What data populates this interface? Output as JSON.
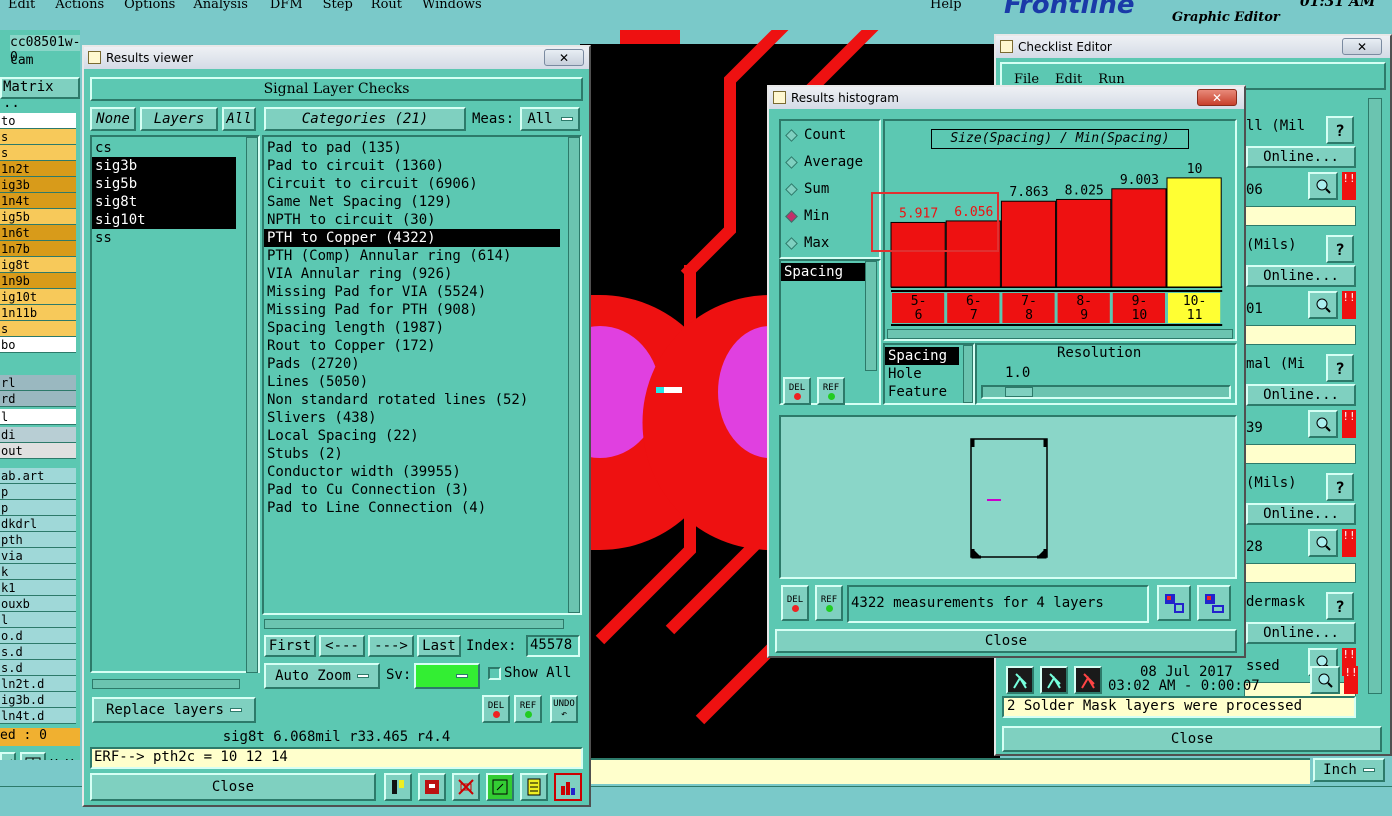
{
  "menubar": {
    "items": [
      "Edit",
      "Actions",
      "Options",
      "Analysis",
      "DFM",
      "Step",
      "Rout",
      "Windows"
    ],
    "help": "Help"
  },
  "brand": {
    "logo": "Frontline",
    "subtitle": "Graphic Editor",
    "time": "01:31 AM"
  },
  "left_panel": {
    "job": "cc08501w-0",
    "step": "cam",
    "matrix": "Matrix ..",
    "layers": [
      {
        "name": "to",
        "color": "#ffffff"
      },
      {
        "name": "s",
        "color": "#f7c95a"
      },
      {
        "name": "s",
        "color": "#f7c95a"
      },
      {
        "name": "1n2t",
        "color": "#d89b1a"
      },
      {
        "name": "ig3b",
        "color": "#d89b1a"
      },
      {
        "name": "1n4t",
        "color": "#d89b1a"
      },
      {
        "name": "ig5b",
        "color": "#f7c95a"
      },
      {
        "name": "1n6t",
        "color": "#d89b1a"
      },
      {
        "name": "1n7b",
        "color": "#d89b1a"
      },
      {
        "name": "ig8t",
        "color": "#f7c95a"
      },
      {
        "name": "1n9b",
        "color": "#d89b1a"
      },
      {
        "name": "ig10t",
        "color": "#f7c95a"
      },
      {
        "name": "1n11b",
        "color": "#f7c95a"
      },
      {
        "name": "s",
        "color": "#f7c95a"
      },
      {
        "name": "bo",
        "color": "#ffffff"
      }
    ],
    "layers2": [
      {
        "name": "rl",
        "color": "#9ab8c0"
      },
      {
        "name": "rd",
        "color": "#9ab8c0"
      },
      {
        "name": "l",
        "color": "#ffffff"
      },
      {
        "name": "di",
        "color": "#b8ced4"
      },
      {
        "name": "out",
        "color": "#e0e0e0"
      }
    ],
    "layers3": [
      "ab.art",
      "p",
      "p",
      "dkdrl",
      "pth",
      "via",
      "k",
      "k1",
      "ouxb",
      "l",
      "o.d",
      "s.d",
      "s.d",
      "ln2t.d",
      "ig3b.d",
      "ln4t.d"
    ],
    "status": "ed : 0",
    "xy": "X Y"
  },
  "results_viewer": {
    "title": "Results viewer",
    "header": "Signal Layer Checks",
    "none_btn": "None",
    "layers_btn": "Layers",
    "all_btn": "All",
    "layers_list": [
      {
        "name": "cs",
        "selected": false
      },
      {
        "name": "sig3b",
        "selected": true
      },
      {
        "name": "sig5b",
        "selected": true
      },
      {
        "name": "sig8t",
        "selected": true
      },
      {
        "name": "sig10t",
        "selected": true
      },
      {
        "name": "ss",
        "selected": false
      }
    ],
    "categories_label": "Categories (21)",
    "meas_label": "Meas:",
    "meas_value": "All",
    "categories": [
      {
        "label": "Pad to pad (135)",
        "selected": false
      },
      {
        "label": "Pad to circuit (1360)",
        "selected": false
      },
      {
        "label": "Circuit to circuit (6906)",
        "selected": false
      },
      {
        "label": "Same Net Spacing (129)",
        "selected": false
      },
      {
        "label": "NPTH to circuit (30)",
        "selected": false
      },
      {
        "label": "PTH to Copper (4322)",
        "selected": true
      },
      {
        "label": "PTH (Comp) Annular ring (614)",
        "selected": false
      },
      {
        "label": "VIA Annular ring (926)",
        "selected": false
      },
      {
        "label": "Missing Pad for VIA (5524)",
        "selected": false
      },
      {
        "label": "Missing Pad for PTH (908)",
        "selected": false
      },
      {
        "label": "Spacing length (1987)",
        "selected": false
      },
      {
        "label": "Rout to Copper (172)",
        "selected": false
      },
      {
        "label": "Pads (2720)",
        "selected": false
      },
      {
        "label": "Lines (5050)",
        "selected": false
      },
      {
        "label": "Non standard rotated lines (52)",
        "selected": false
      },
      {
        "label": "Slivers (438)",
        "selected": false
      },
      {
        "label": "Local Spacing (22)",
        "selected": false
      },
      {
        "label": "Stubs (2)",
        "selected": false
      },
      {
        "label": "Conductor width (39955)",
        "selected": false
      },
      {
        "label": "Pad to Cu Connection (3)",
        "selected": false
      },
      {
        "label": "Pad to Line Connection (4)",
        "selected": false
      }
    ],
    "first": "First",
    "prev": "<---",
    "next": "--->",
    "last": "Last",
    "index_label": "Index:",
    "index_value": "45578",
    "auto_zoom": "Auto Zoom",
    "sv_label": "Sv:",
    "show_all": "Show All",
    "replace_layers": "Replace layers",
    "del": "DEL",
    "ref": "REF",
    "undo": "UNDO",
    "info": "sig8t 6.068mil  r33.465  r4.4",
    "erf": "ERF--> pth2c = 10 12 14",
    "close": "Close"
  },
  "histogram": {
    "title": "Results histogram",
    "modes": [
      {
        "label": "Count",
        "selected": false
      },
      {
        "label": "Average",
        "selected": false
      },
      {
        "label": "Sum",
        "selected": false
      },
      {
        "label": "Min",
        "selected": true
      },
      {
        "label": "Max",
        "selected": false
      }
    ],
    "attr_list": [
      "Spacing"
    ],
    "chart_title": "Size(Spacing) / Min(Spacing)",
    "del": "DEL",
    "ref": "REF",
    "type_options": [
      {
        "label": "Spacing",
        "selected": true
      },
      {
        "label": "Hole",
        "selected": false
      },
      {
        "label": "Feature",
        "selected": false
      }
    ],
    "resolution_label": "Resolution",
    "resolution_value": "1.0",
    "summary": "4322 measurements for 4 layers",
    "close": "Close"
  },
  "chart_data": {
    "type": "bar",
    "title": "Size(Spacing) / Min(Spacing)",
    "categories": [
      "5-\n6",
      "6-\n7",
      "7-\n8",
      "8-\n9",
      "9-\n10",
      "10-\n11"
    ],
    "values": [
      5.917,
      6.056,
      7.863,
      8.025,
      9.003,
      10
    ],
    "value_labels": [
      "5.917",
      "6.056",
      "7.863",
      "8.025",
      "9.003",
      "10"
    ],
    "colors": [
      "#ee1111",
      "#ee1111",
      "#ee1111",
      "#ee1111",
      "#ee1111",
      "#ffff33"
    ],
    "ylim": [
      0,
      11
    ]
  },
  "checklist": {
    "title": "Checklist Editor",
    "menu": [
      "File",
      "Edit",
      "Run"
    ],
    "rows": [
      {
        "text": "ll (Mil",
        "sub": "06"
      },
      {
        "text": "(Mils)",
        "sub": "01"
      },
      {
        "text": "mal (Mi",
        "sub": "39"
      },
      {
        "text": "(Mils)",
        "sub": "28"
      },
      {
        "text": "dermask",
        "sub": "ssed"
      }
    ],
    "online": "Online...",
    "date": "08 Jul 2017",
    "time": "03:02 AM - 0:00:07",
    "message": "2 Solder Mask layers were processed",
    "close": "Close",
    "unit": "Inch"
  }
}
